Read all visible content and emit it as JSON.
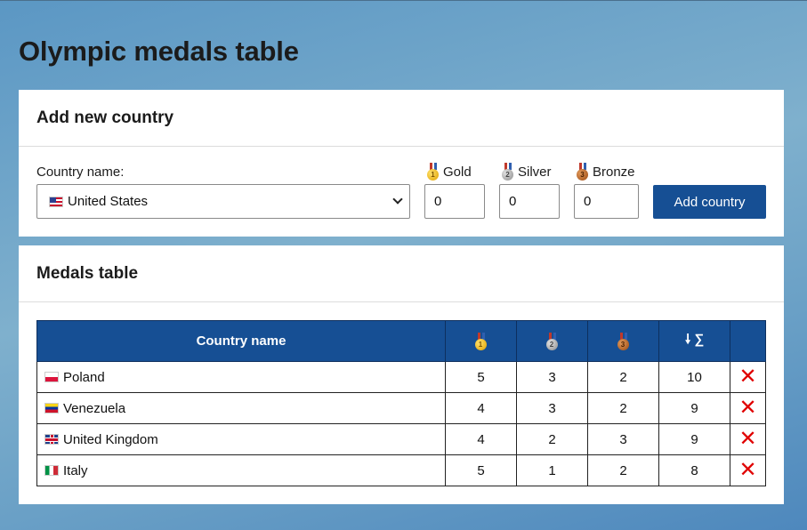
{
  "page": {
    "title": "Olympic medals table"
  },
  "add_panel": {
    "header": "Add new country",
    "country_label": "Country name:",
    "country_selected": "United States",
    "country_flag": "us-flag-icon",
    "gold_label": "Gold",
    "silver_label": "Silver",
    "bronze_label": "Bronze",
    "gold_value": "0",
    "silver_value": "0",
    "bronze_value": "0",
    "add_button": "Add country"
  },
  "table_panel": {
    "header": "Medals table",
    "columns": {
      "name": "Country name",
      "gold": "gold-medal-icon",
      "silver": "silver-medal-icon",
      "bronze": "bronze-medal-icon",
      "total": "sort-down-sum-icon"
    },
    "rows": [
      {
        "flag": "pl",
        "name": "Poland",
        "gold": "5",
        "silver": "3",
        "bronze": "2",
        "total": "10"
      },
      {
        "flag": "ve",
        "name": "Venezuela",
        "gold": "4",
        "silver": "3",
        "bronze": "2",
        "total": "9"
      },
      {
        "flag": "uk",
        "name": "United Kingdom",
        "gold": "4",
        "silver": "2",
        "bronze": "3",
        "total": "9"
      },
      {
        "flag": "it",
        "name": "Italy",
        "gold": "5",
        "silver": "1",
        "bronze": "2",
        "total": "8"
      }
    ]
  },
  "colors": {
    "accent": "#164f94",
    "delete": "#e00000"
  }
}
